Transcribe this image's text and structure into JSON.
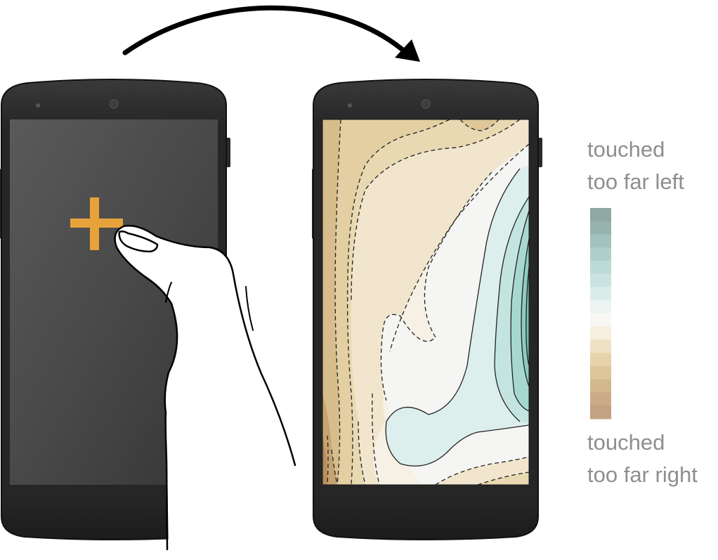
{
  "legend": {
    "top_line1": "touched",
    "top_line2": "too far left",
    "bottom_line1": "touched",
    "bottom_line2": "too far right",
    "scale_colors": [
      "#8fa8a3",
      "#97b4ae",
      "#a2c3bd",
      "#aecfca",
      "#bcdad6",
      "#cbe3e0",
      "#dcecea",
      "#ecf4f2",
      "#f8f7f2",
      "#f7efdf",
      "#efe1c3",
      "#e6d3ab",
      "#dcc69a",
      "#d3b88e",
      "#cbab88",
      "#c2a283"
    ]
  },
  "colors": {
    "phone_body": "#2b2b2b",
    "crosshair": "#e7a33a",
    "teal": "#8bcdc4",
    "tan": "#cdae7b"
  },
  "icons": {
    "crosshair": "plus-crosshair-icon",
    "arrow": "curved-arrow-icon",
    "hand": "hand-icon"
  }
}
